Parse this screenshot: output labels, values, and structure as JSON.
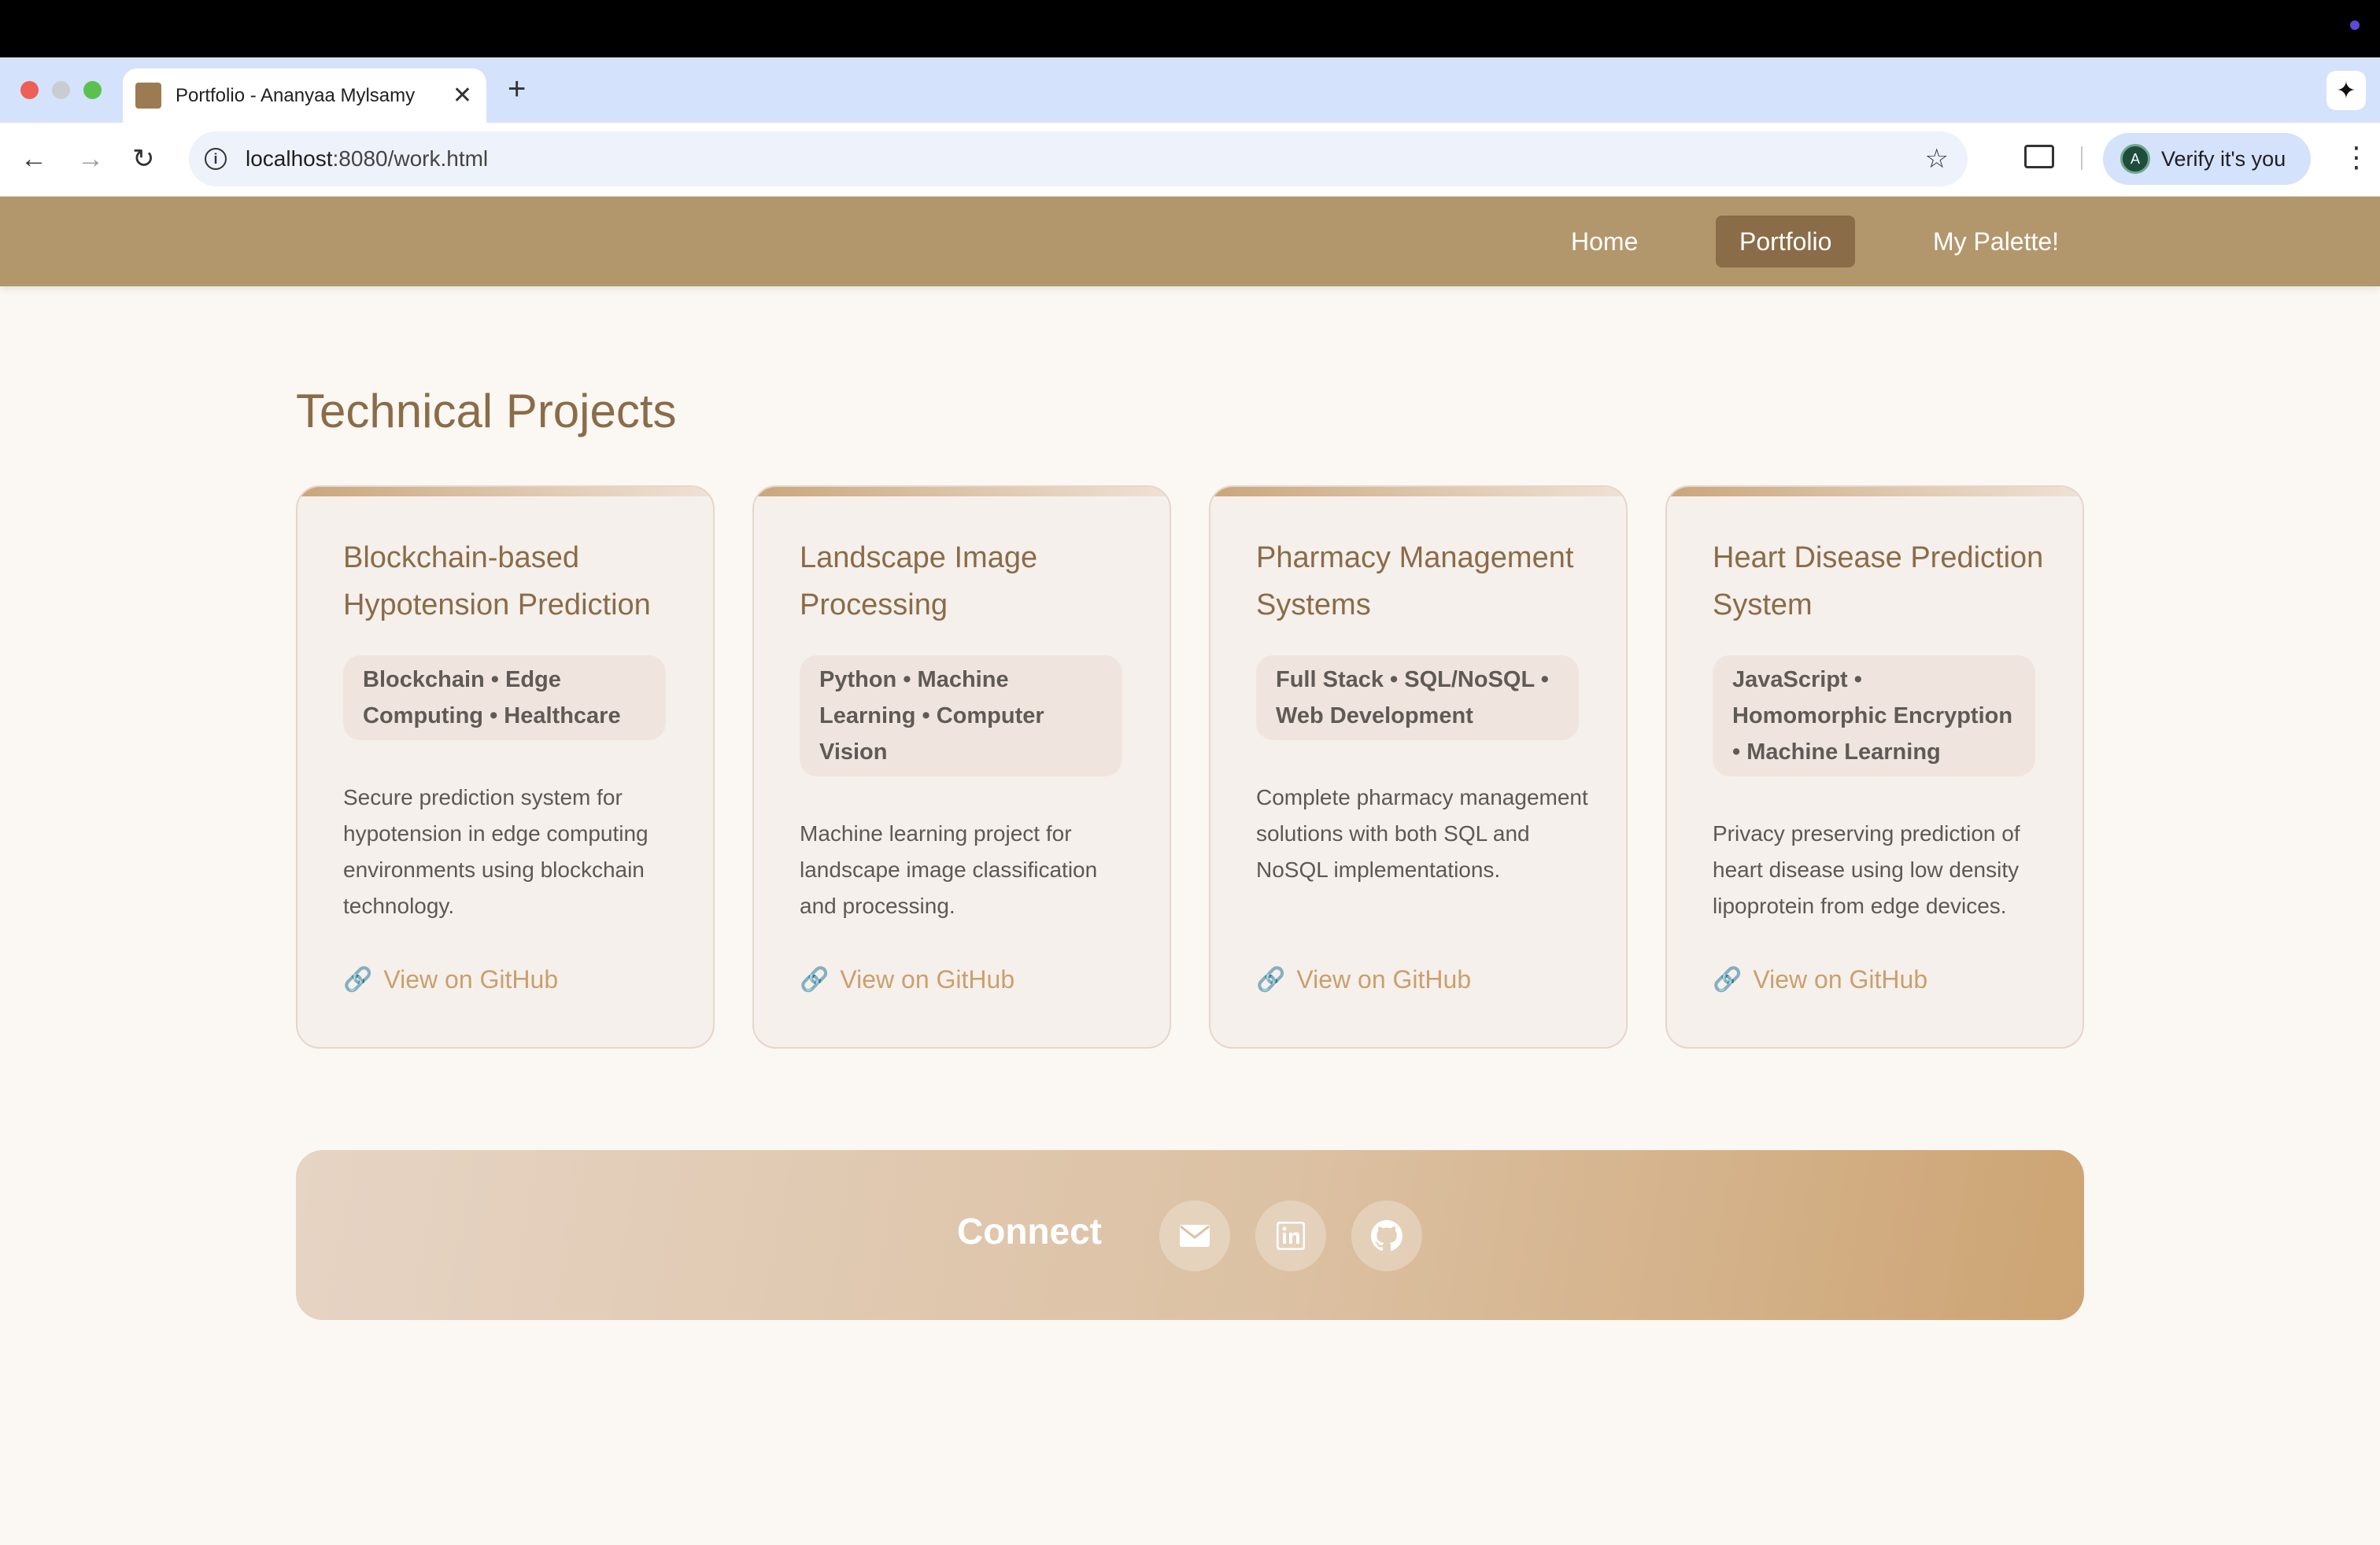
{
  "browser": {
    "tab_title": "Portfolio - Ananyaa Mylsamy",
    "tab_close": "✕",
    "new_tab": "+",
    "url_host": "localhost",
    "url_path": ":8080/work.html",
    "verify_label": "Verify it's you",
    "avatar_letter": "A"
  },
  "nav": {
    "items": [
      {
        "label": "Home",
        "active": false
      },
      {
        "label": "Portfolio",
        "active": true
      },
      {
        "label": "My Palette!",
        "active": false
      }
    ]
  },
  "main": {
    "heading": "Technical Projects",
    "projects": [
      {
        "title": "Blockchain-based Hypotension Prediction",
        "tags": "Blockchain • Edge Computing • Healthcare",
        "description": "Secure prediction system for hypotension in edge computing environments using blockchain technology.",
        "link_label": "View on GitHub"
      },
      {
        "title": "Landscape Image Processing",
        "tags": "Python • Machine Learning • Computer Vision",
        "description": "Machine learning project for landscape image classification and processing.",
        "link_label": "View on GitHub"
      },
      {
        "title": "Pharmacy Management Systems",
        "tags": "Full Stack • SQL/NoSQL • Web Development",
        "description": "Complete pharmacy management solutions with both SQL and NoSQL implementations.",
        "link_label": "View on GitHub"
      },
      {
        "title": "Heart Disease Prediction System",
        "tags": "JavaScript • Homomorphic Encryption • Machine Learning",
        "description": "Privacy preserving prediction of heart disease using low density lipoprotein from edge devices.",
        "link_label": "View on GitHub"
      }
    ]
  },
  "footer": {
    "connect_label": "Connect",
    "social_icons": [
      "mail-icon",
      "linkedin-icon",
      "github-icon"
    ]
  },
  "colors": {
    "nav_bg": "#b3976c",
    "nav_active": "#8a6c48",
    "heading": "#8a6c48",
    "link": "#c9a06d",
    "page_bg": "#fbf7f3"
  }
}
